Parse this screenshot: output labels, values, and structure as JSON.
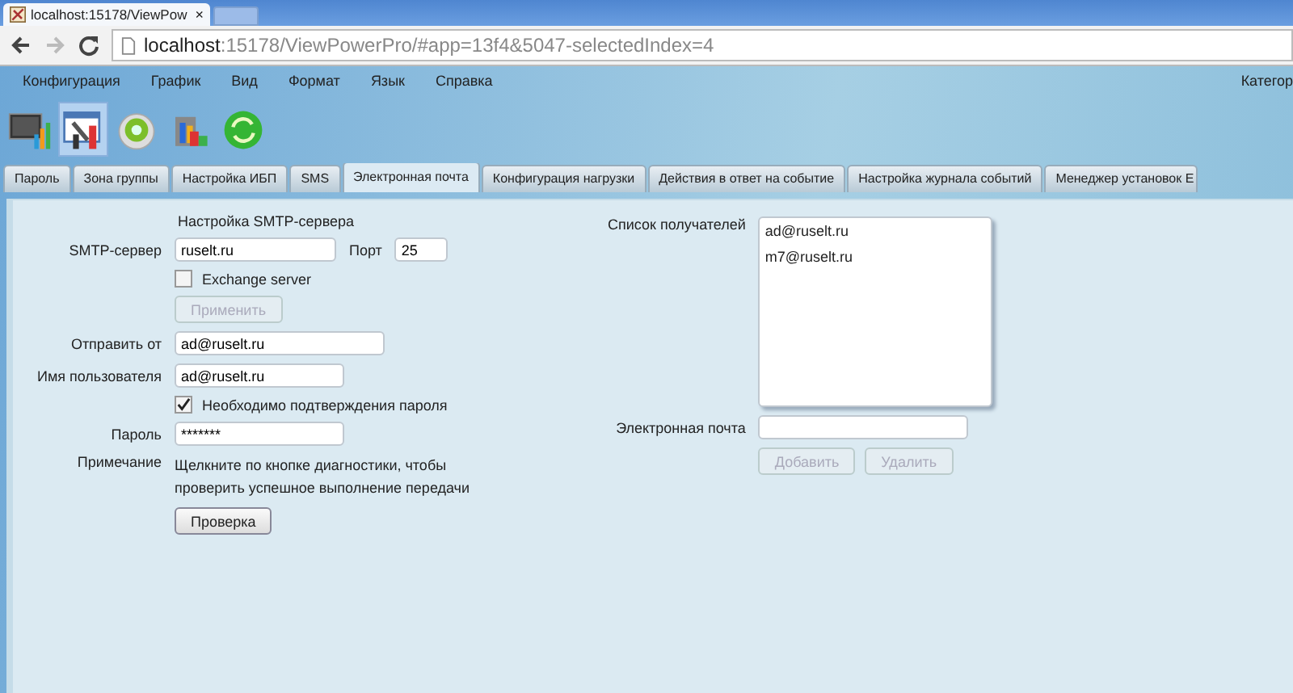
{
  "browser": {
    "tab_title": "localhost:15178/ViewPow",
    "tab_close": "×",
    "url_host": "localhost",
    "url_rest": ":15178/ViewPowerPro/#app=13f4&5047-selectedIndex=4"
  },
  "menu": [
    "Конфигурация",
    "График",
    "Вид",
    "Формат",
    "Язык",
    "Справка"
  ],
  "category": "Категор",
  "toolbar": [
    {
      "kind": "monitor",
      "selected": false
    },
    {
      "kind": "tools",
      "selected": true
    },
    {
      "kind": "gear",
      "selected": false
    },
    {
      "kind": "chart",
      "selected": false
    },
    {
      "kind": "refresh",
      "selected": false
    }
  ],
  "tabs": [
    {
      "label": "Пароль",
      "selected": false
    },
    {
      "label": "Зона группы",
      "selected": false
    },
    {
      "label": "Настройка ИБП",
      "selected": false
    },
    {
      "label": "SMS",
      "selected": false
    },
    {
      "label": "Электронная почта",
      "selected": true
    },
    {
      "label": "Конфигурация нагрузки",
      "selected": false
    },
    {
      "label": "Действия в ответ на событие",
      "selected": false
    },
    {
      "label": "Настройка журнала событий",
      "selected": false
    },
    {
      "label": "Менеджер установок E",
      "selected": false
    }
  ],
  "smtp": {
    "heading": "Настройка SMTP-сервера",
    "server_label": "SMTP-сервер",
    "server": "ruselt.ru",
    "port_label": "Порт",
    "port": "25",
    "exchange": {
      "label": "Exchange server",
      "checked": false
    },
    "apply": {
      "label": "Применить",
      "disabled": true
    },
    "from_label": "Отправить от",
    "from": "ad@ruselt.ru",
    "user_label": "Имя пользователя",
    "user": "ad@ruselt.ru",
    "confirm": {
      "label": "Необходимо подтверждения пароля",
      "checked": true
    },
    "password_label": "Пароль",
    "password": "*******",
    "note_label": "Примечание",
    "note": "Щелкните по кнопке диагностики, чтобы проверить успешное выполнение передачи",
    "test": {
      "label": "Проверка",
      "disabled": false
    }
  },
  "recipients": {
    "label": "Список получателей",
    "items": [
      "ad@ruselt.ru",
      "m7@ruselt.ru"
    ],
    "email_label": "Электронная почта",
    "add": {
      "label": "Добавить",
      "disabled": true
    },
    "remove": {
      "label": "Удалить",
      "disabled": true
    }
  }
}
